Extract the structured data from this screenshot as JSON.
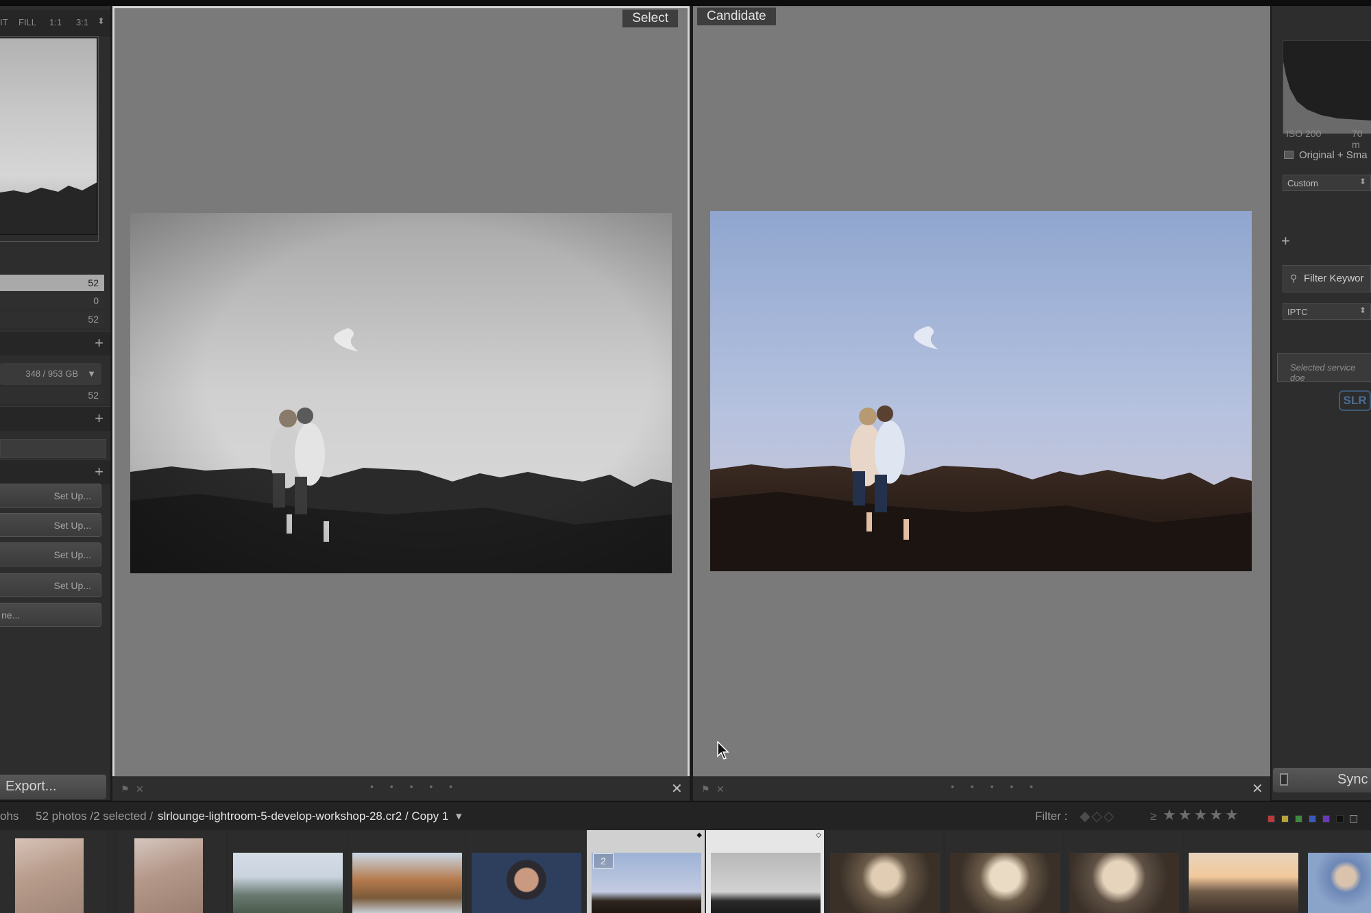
{
  "navigator": {
    "zoom_fit": "IT",
    "zoom_fill": "FILL",
    "zoom_1_1": "1:1",
    "zoom_3_1": "3:1",
    "zoom_arrow": "⬍"
  },
  "catalog": {
    "rows": [
      {
        "value": "52"
      },
      {
        "value": "0"
      },
      {
        "value": "52"
      }
    ]
  },
  "folders": {
    "disk_label": "348 / 953 GB",
    "disk_count": "52"
  },
  "publish_services": {
    "setup_label": "Set Up...",
    "find_more_label": "ne..."
  },
  "left_buttons": {
    "export_label": "Export..."
  },
  "compare": {
    "select_label": "Select",
    "candidate_label": "Candidate",
    "toolbar_dots": "• • • • •",
    "close_glyph": "✕"
  },
  "right_panel": {
    "iso": "ISO 200",
    "focal": "70 m",
    "original_label": "Original + Sma",
    "preset_value": "Custom",
    "filter_keywords": "Filter Keywor",
    "metadata_preset": "IPTC",
    "service_text": "Selected service doe",
    "slr_logo": "SLR",
    "sync_label": "Sync"
  },
  "filmstrip_bar": {
    "photos_left": "ohs",
    "count_text": "52 photos /2 selected /",
    "filename": "slrlounge-lightroom-5-develop-workshop-28.cr2 / Copy 1",
    "dropdown_arrow": "▾",
    "filter_label": "Filter :",
    "rating_op": "≥",
    "stars": [
      "★",
      "★",
      "★",
      "★",
      "★"
    ]
  },
  "filmstrip": {
    "selected_index_badge": "2",
    "marker_filled": "◆",
    "marker_hollow": "◇"
  },
  "colors": {
    "label_red": "#b83a3a",
    "label_yellow": "#b8a23a",
    "label_green": "#3e8a3e",
    "label_blue": "#3a5ab8",
    "label_purple": "#6a3ab8"
  }
}
